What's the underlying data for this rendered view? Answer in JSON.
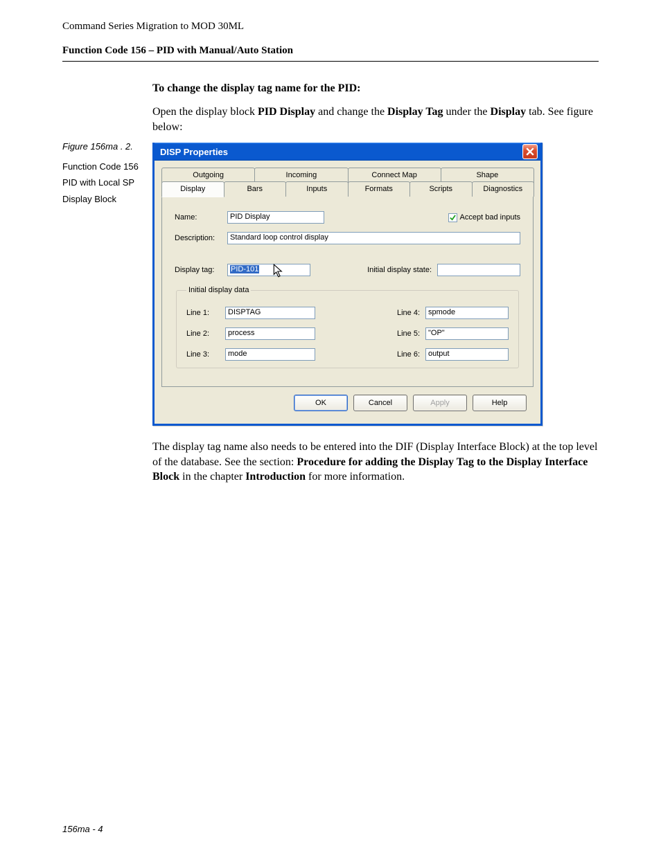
{
  "doc": {
    "header": "Command Series Migration to MOD 30ML",
    "section": "Function Code 156 – PID with Manual/Auto Station",
    "footer": "156ma - 4"
  },
  "sidebar": {
    "figure_label": "Figure 156ma . 2.",
    "lines": [
      "Function Code 156",
      "PID with Local SP",
      "Display Block"
    ]
  },
  "intro": {
    "heading": "To change the display tag name for the PID:",
    "para_pre": "Open the display block ",
    "b1": "PID Display",
    "mid1": " and change the ",
    "b2": "Display Tag",
    "mid2": " under the ",
    "b3": "Display",
    "tail": " tab. See figure below:"
  },
  "dialog": {
    "title": "DISP Properties",
    "tabs_back": [
      "Outgoing",
      "Incoming",
      "Connect Map",
      "Shape"
    ],
    "tabs_front": [
      "Display",
      "Bars",
      "Inputs",
      "Formats",
      "Scripts",
      "Diagnostics"
    ],
    "fields": {
      "name_label": "Name:",
      "name_value": "PID Display",
      "accept_bad": "Accept bad inputs",
      "desc_label": "Description:",
      "desc_value": "Standard loop control display",
      "disptag_label": "Display tag:",
      "disptag_value": "PID-101",
      "initstate_label": "Initial display state:",
      "initstate_value": "",
      "fieldset_legend": "Initial display data",
      "l1_label": "Line 1:",
      "l1_value": "DISPTAG",
      "l2_label": "Line 2:",
      "l2_value": "process",
      "l3_label": "Line 3:",
      "l3_value": "mode",
      "l4_label": "Line 4:",
      "l4_value": "spmode",
      "l5_label": "Line 5:",
      "l5_value": "\"OP\"",
      "l6_label": "Line 6:",
      "l6_value": "output"
    },
    "buttons": {
      "ok": "OK",
      "cancel": "Cancel",
      "apply": "Apply",
      "help": "Help"
    }
  },
  "outro": {
    "pre": "The display tag name also needs to be entered into the DIF (Display Interface Block) at the top level of the database. See the section: ",
    "b1": "Procedure for adding the Display Tag to the Display Interface Block",
    "mid": " in the chapter ",
    "b2": "Introduction",
    "tail": " for more information."
  }
}
